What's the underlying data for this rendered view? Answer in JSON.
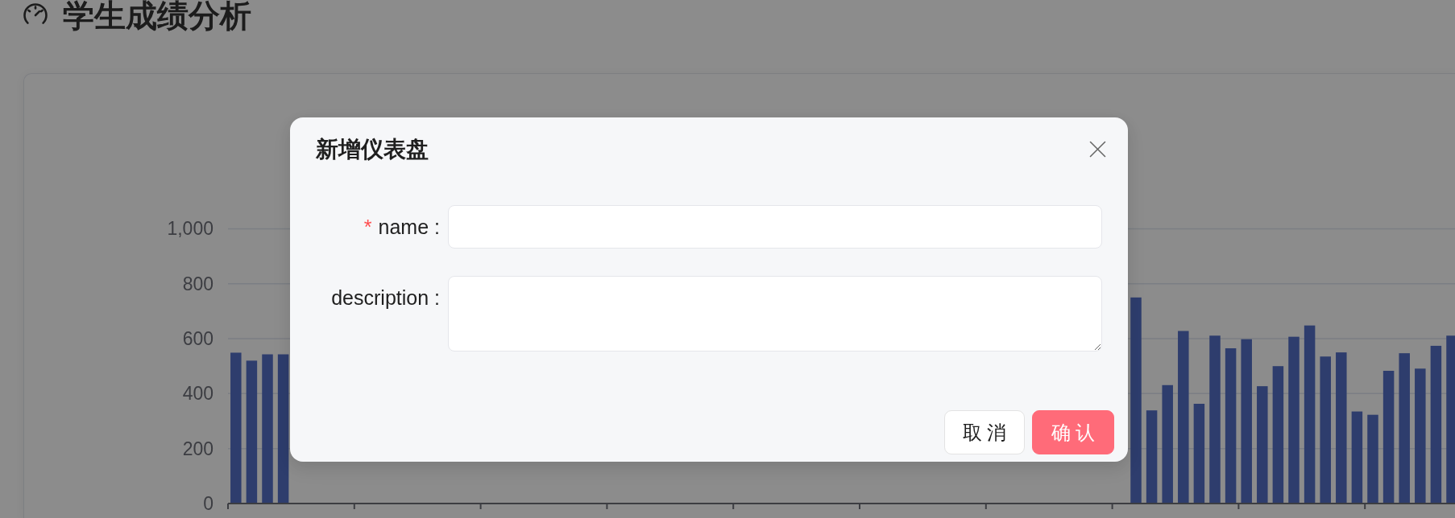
{
  "page": {
    "title": "学生成绩分析"
  },
  "chart": {
    "chart_data": {
      "type": "bar",
      "grid": true,
      "ylim": [
        0,
        1000
      ],
      "yticks": [
        0,
        200,
        400,
        600,
        800,
        {
          "value": 1000,
          "label": "1,000"
        }
      ],
      "values": [
        549,
        520,
        543,
        543,
        null,
        null,
        null,
        null,
        null,
        null,
        null,
        null,
        null,
        null,
        null,
        null,
        null,
        null,
        null,
        null,
        null,
        null,
        null,
        null,
        null,
        null,
        null,
        null,
        null,
        null,
        null,
        null,
        null,
        null,
        null,
        null,
        null,
        null,
        null,
        null,
        null,
        null,
        null,
        null,
        null,
        null,
        null,
        null,
        null,
        null,
        null,
        null,
        null,
        null,
        null,
        null,
        null,
        750,
        339,
        431,
        628,
        363,
        611,
        565,
        598,
        427,
        500,
        607,
        648,
        535,
        550,
        335,
        323,
        483,
        547,
        491,
        574,
        611
      ]
    }
  },
  "dialog": {
    "title": "新增仪表盘",
    "fields": [
      {
        "kind": "input",
        "label": "name :",
        "required_mark": "*"
      },
      {
        "kind": "textarea",
        "label": "description :"
      }
    ],
    "buttons": [
      {
        "kind": "cancel",
        "label": "取 消"
      },
      {
        "kind": "confirm",
        "label": "确 认"
      }
    ]
  }
}
